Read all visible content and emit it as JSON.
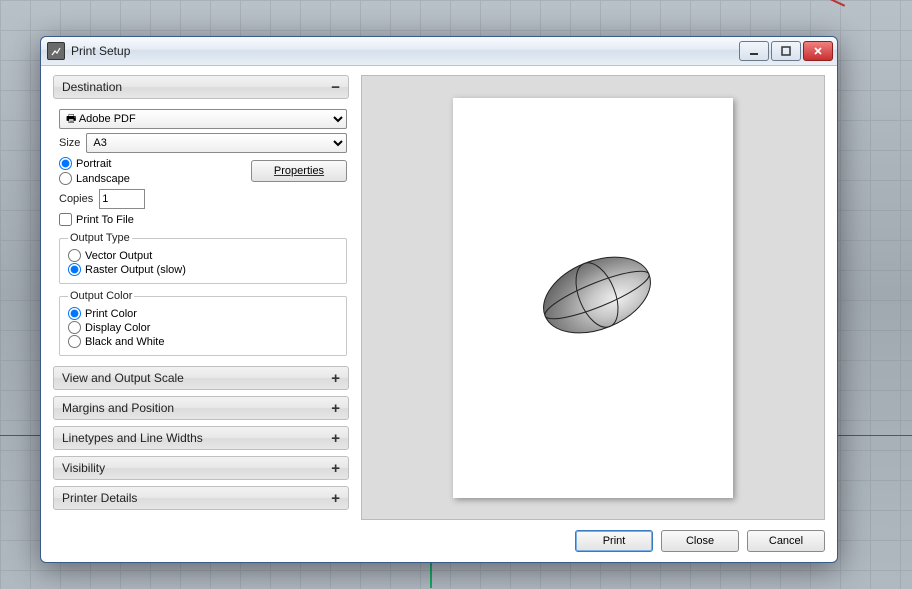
{
  "window": {
    "title": "Print Setup"
  },
  "sections": {
    "destination": "Destination",
    "view_scale": "View and Output Scale",
    "margins": "Margins and Position",
    "linetypes": "Linetypes and Line Widths",
    "visibility": "Visibility",
    "printer_details": "Printer Details"
  },
  "destination": {
    "printer": "Adobe PDF",
    "size_label": "Size",
    "size": "A3",
    "orientation": {
      "portrait": "Portrait",
      "landscape": "Landscape",
      "selected": "portrait"
    },
    "properties_btn": "Properties",
    "copies_label": "Copies",
    "copies": "1",
    "print_to_file": "Print To File",
    "output_type": {
      "legend": "Output Type",
      "vector": "Vector Output",
      "raster": "Raster Output (slow)",
      "selected": "raster"
    },
    "output_color": {
      "legend": "Output Color",
      "print": "Print Color",
      "display": "Display Color",
      "bw": "Black and White",
      "selected": "print"
    }
  },
  "buttons": {
    "print": "Print",
    "close": "Close",
    "cancel": "Cancel"
  }
}
